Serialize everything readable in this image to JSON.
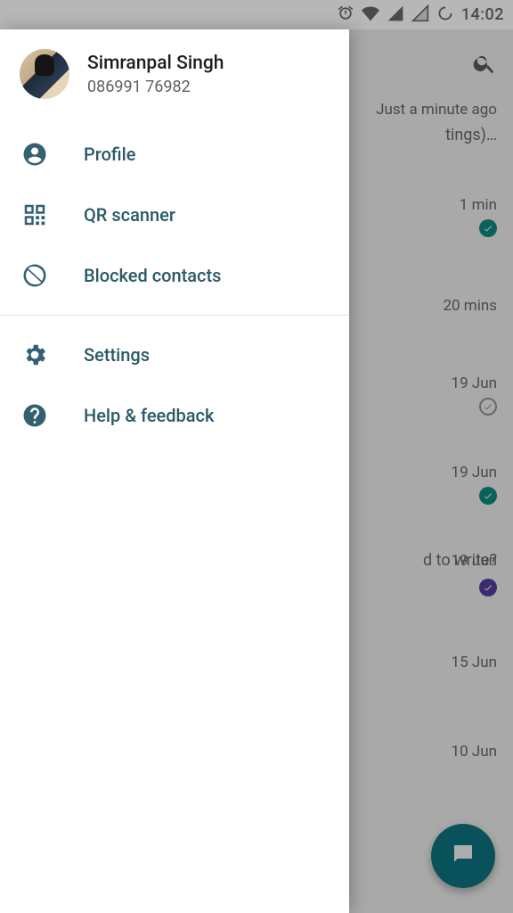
{
  "status_bar": {
    "time": "14:02"
  },
  "profile": {
    "name": "Simranpal Singh",
    "phone": "086991 76982"
  },
  "nav": {
    "profile": "Profile",
    "qr": "QR scanner",
    "blocked": "Blocked contacts",
    "settings": "Settings",
    "help": "Help & feedback"
  },
  "bg": {
    "first_time": "Just a minute ago",
    "first_snippet": "tings)…",
    "third_snippet": "d to write?",
    "items": [
      {
        "time": "1 min",
        "status": "teal"
      },
      {
        "time": "20 mins",
        "status": "none"
      },
      {
        "time": "19 Jun",
        "status": "outline"
      },
      {
        "time": "19 Jun",
        "status": "teal"
      },
      {
        "time": "19 Jun",
        "status": "purple"
      },
      {
        "time": "15 Jun",
        "status": "none"
      },
      {
        "time": "10 Jun",
        "status": "none"
      }
    ]
  }
}
